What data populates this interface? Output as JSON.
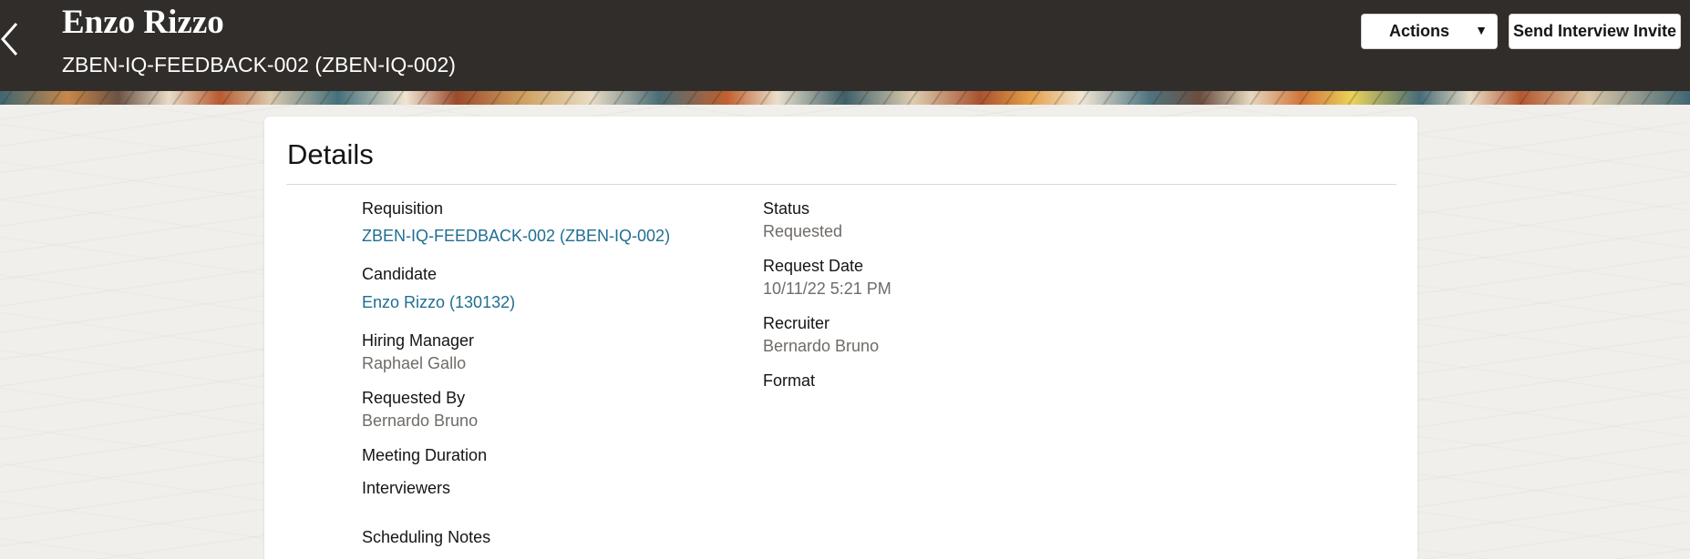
{
  "header": {
    "title": "Enzo Rizzo",
    "subtitle": "ZBEN-IQ-FEEDBACK-002 (ZBEN-IQ-002)",
    "back_icon": "chevron-left-icon",
    "actions_label": "Actions",
    "actions_caret": "▼",
    "send_invite_label": "Send Interview Invite",
    "background_color": "#312d2a"
  },
  "details": {
    "title": "Details",
    "left_column": {
      "requisition": {
        "label": "Requisition",
        "value": "ZBEN-IQ-FEEDBACK-002 (ZBEN-IQ-002)"
      },
      "candidate": {
        "label": "Candidate",
        "value": "Enzo Rizzo (130132)"
      },
      "hiring_manager": {
        "label": "Hiring Manager",
        "value": "Raphael Gallo"
      },
      "requested_by": {
        "label": "Requested By",
        "value": "Bernardo Bruno"
      },
      "meeting_duration": {
        "label": "Meeting Duration",
        "value": ""
      },
      "interviewers": {
        "label": "Interviewers",
        "value": ""
      },
      "scheduling_notes": {
        "label": "Scheduling Notes",
        "value": ""
      }
    },
    "right_column": {
      "status": {
        "label": "Status",
        "value": "Requested"
      },
      "request_date": {
        "label": "Request Date",
        "value": "10/11/22 5:21 PM"
      },
      "recruiter": {
        "label": "Recruiter",
        "value": "Bernardo Bruno"
      },
      "format": {
        "label": "Format",
        "value": ""
      }
    }
  },
  "colors": {
    "link": "#1f6e92",
    "value_text": "#6f6b67",
    "label_text": "#161513"
  }
}
